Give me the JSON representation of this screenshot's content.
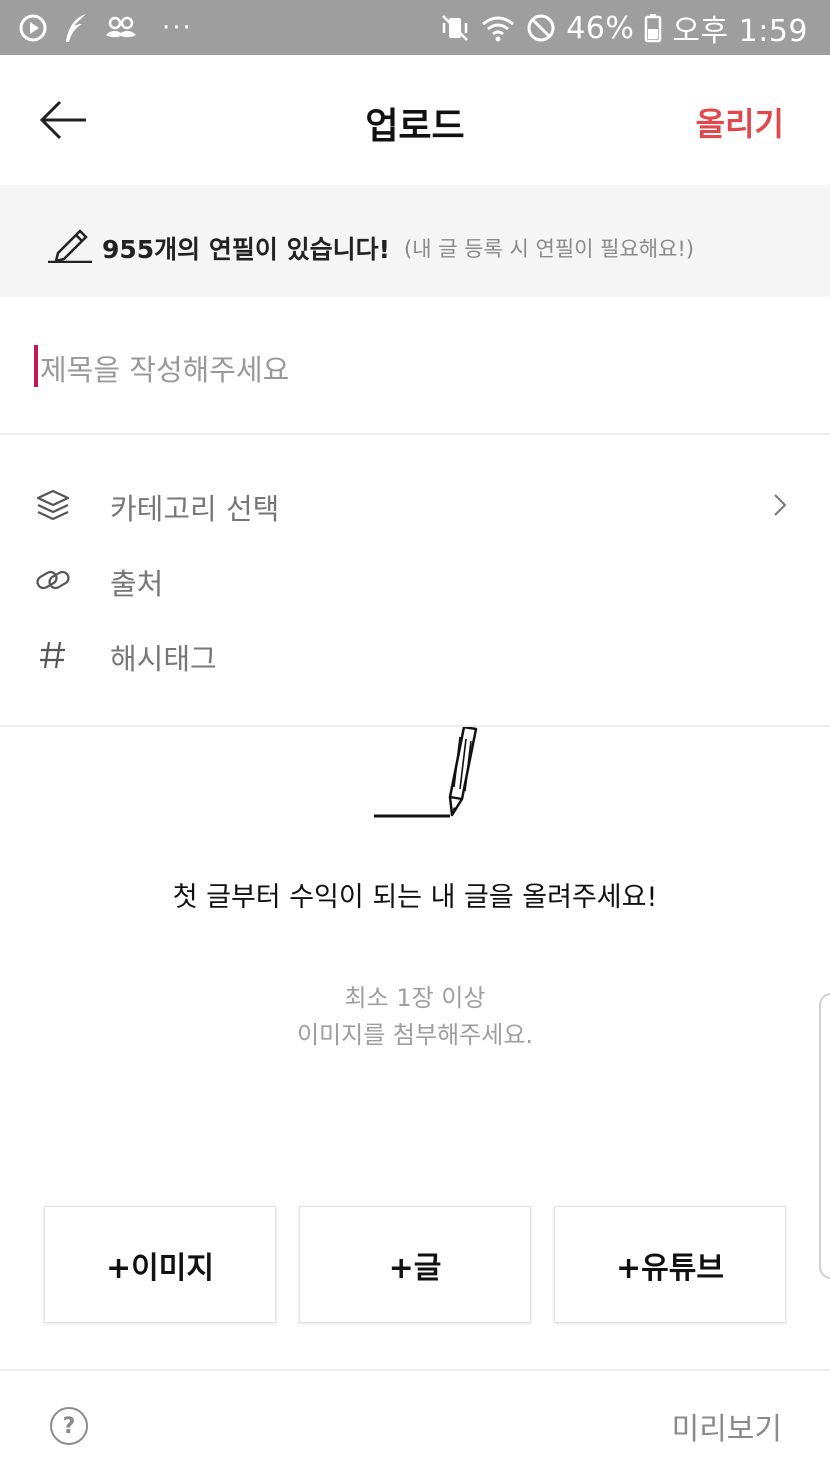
{
  "status_bar": {
    "battery": "46%",
    "time": "오후 1:59",
    "more": "···",
    "left_icons": [
      "play-circle-icon",
      "quill-icon",
      "mustache-icon"
    ],
    "right_icons": [
      "vibrate-off-icon",
      "wifi-icon",
      "do-not-disturb-icon",
      "battery-icon"
    ]
  },
  "app_bar": {
    "title": "업로드",
    "action_label": "올리기",
    "action_color": "#e2474b",
    "back_icon": "arrow-left-icon"
  },
  "banner": {
    "pencil_count_text": "955개의 연필이 있습니다!",
    "note": "(내 글 등록 시 연필이 필요해요!)",
    "icon": "pencil-icon"
  },
  "title_input": {
    "placeholder": "제목을 작성해주세요",
    "cursor_color": "#c2185b"
  },
  "options": [
    {
      "label": "카테고리 선택",
      "icon": "layers-icon",
      "has_chevron": true
    },
    {
      "label": "출처",
      "icon": "link-icon",
      "has_chevron": false
    },
    {
      "label": "해시태그",
      "icon": "hash-icon",
      "has_chevron": false
    }
  ],
  "empty_state": {
    "headline": "첫 글부터 수익이 되는 내 글을 올려주세요!",
    "hint_line_1": "최소 1장 이상",
    "hint_line_2": "이미지를 첨부해주세요."
  },
  "add_buttons": [
    {
      "label": "+이미지"
    },
    {
      "label": "+글"
    },
    {
      "label": "+유튜브"
    }
  ],
  "bottom_bar": {
    "help_label": "?",
    "preview_label": "미리보기"
  }
}
